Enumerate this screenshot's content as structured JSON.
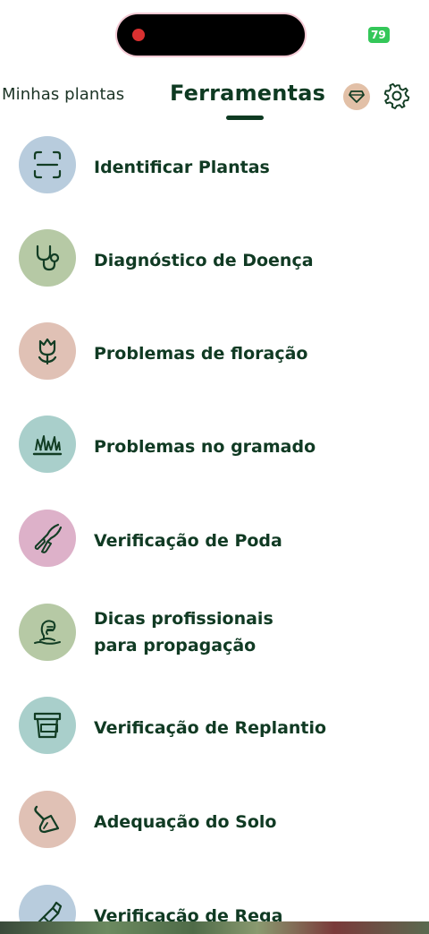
{
  "status_bar": {
    "battery": "79"
  },
  "header": {
    "tabs": [
      {
        "label": "Minhas plantas",
        "active": false
      },
      {
        "label": "Ferramentas",
        "active": true
      }
    ],
    "premium_icon": "diamond-icon",
    "settings_icon": "gear-icon"
  },
  "tools": [
    {
      "label": "Identificar Plantas",
      "icon": "scan-icon",
      "color": "#b8ccdd"
    },
    {
      "label": "Diagnóstico de Doença",
      "icon": "stethoscope-icon",
      "color": "#b6c9a5"
    },
    {
      "label": "Problemas de floração",
      "icon": "tulip-icon",
      "color": "#e0c1b5"
    },
    {
      "label": "Problemas no gramado",
      "icon": "grass-icon",
      "color": "#a9cfcb"
    },
    {
      "label": "Verificação de Poda",
      "icon": "pruning-shears-icon",
      "color": "#ddb1c9"
    },
    {
      "label": "Dicas profissionais\npara propagação",
      "icon": "seedling-hand-icon",
      "color": "#b6c9a5"
    },
    {
      "label": "Verificação de Replantio",
      "icon": "pot-icon",
      "color": "#a9cfcb"
    },
    {
      "label": "Adequação do Solo",
      "icon": "trowel-icon",
      "color": "#e0c1b5"
    },
    {
      "label": "Verificação de Rega",
      "icon": "watering-can-icon",
      "color": "#b8ccdd"
    }
  ]
}
